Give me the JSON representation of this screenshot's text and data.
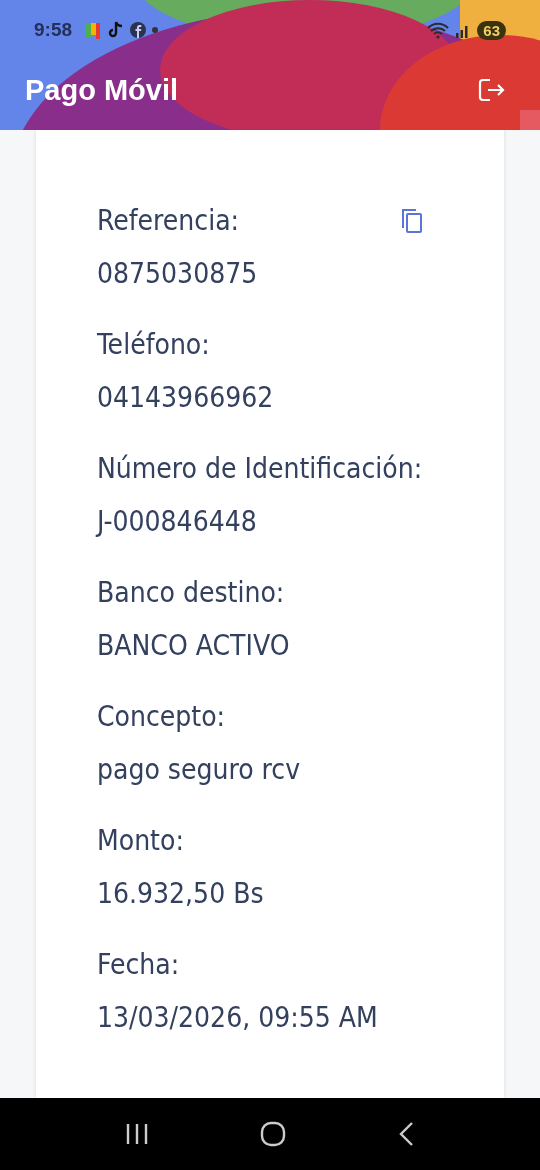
{
  "status_bar": {
    "time": "9:58",
    "battery": "63"
  },
  "app_bar": {
    "title": "Pago Móvil"
  },
  "fields": [
    {
      "label": "Referencia:",
      "value": "0875030875",
      "copyable": true
    },
    {
      "label": "Teléfono:",
      "value": "04143966962"
    },
    {
      "label": "Número de Identificación:",
      "value": "J-000846448"
    },
    {
      "label": "Banco destino:",
      "value": "BANCO ACTIVO"
    },
    {
      "label": "Concepto:",
      "value": "pago seguro rcv"
    },
    {
      "label": "Monto:",
      "value": "16.932,50 Bs"
    },
    {
      "label": "Fecha:",
      "value": "13/03/2026, 09:55 AM"
    }
  ]
}
